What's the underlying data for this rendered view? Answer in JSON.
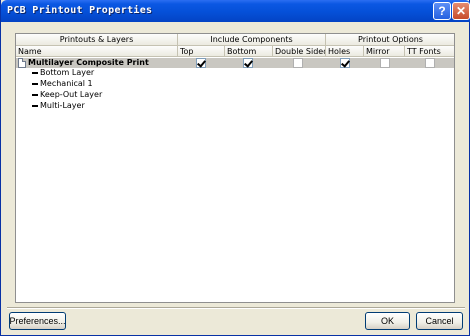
{
  "window": {
    "title": "PCB Printout Properties",
    "help_label": "?",
    "close_label": "✕"
  },
  "grid": {
    "group_headers": {
      "printouts_layers": "Printouts & Layers",
      "include_components": "Include Components",
      "printout_options": "Printout Options"
    },
    "columns": {
      "name": "Name",
      "top": "Top",
      "bottom": "Bottom",
      "double_sided": "Double Sided",
      "holes": "Holes",
      "mirror": "Mirror",
      "tt_fonts": "TT Fonts"
    },
    "printout": {
      "name": "Multilayer Composite Print",
      "top": true,
      "bottom": true,
      "double_sided": false,
      "holes": true,
      "mirror": false,
      "tt_fonts": false
    },
    "layers": [
      {
        "name": "Bottom Layer"
      },
      {
        "name": "Mechanical 1"
      },
      {
        "name": "Keep-Out Layer"
      },
      {
        "name": "Multi-Layer"
      }
    ]
  },
  "buttons": {
    "preferences": "Preferences...",
    "ok": "OK",
    "cancel": "Cancel"
  }
}
